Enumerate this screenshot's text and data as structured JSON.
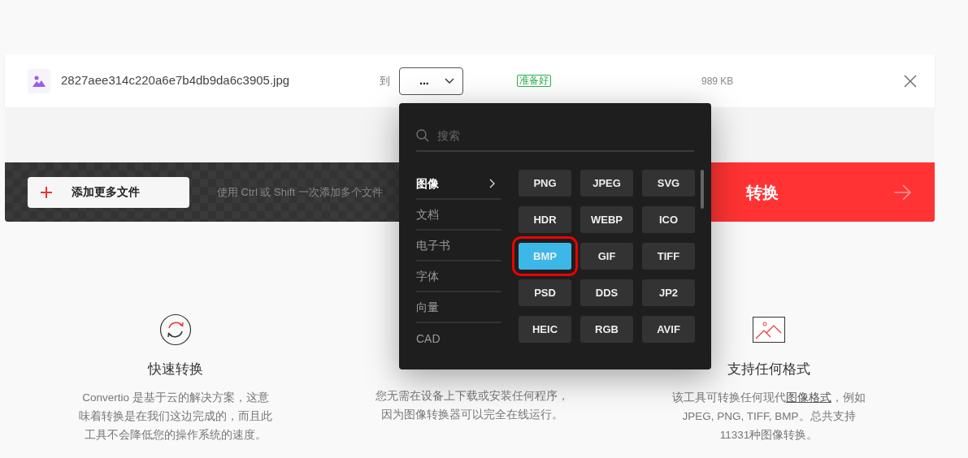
{
  "file": {
    "name": "2827aee314c220a6e7b4db9da6c3905.jpg",
    "to_label": "到",
    "format_select": {
      "value": "..."
    },
    "status": "准备好",
    "size": "989 KB"
  },
  "toolbar": {
    "add_button": "添加更多文件",
    "hint": "使用 Ctrl 或 Shift 一次添加多个文件",
    "convert_button": "转换"
  },
  "dropdown": {
    "search": {
      "placeholder": "搜索"
    },
    "categories": [
      {
        "label": "图像",
        "selected": true
      },
      {
        "label": "文档",
        "selected": false
      },
      {
        "label": "电子书",
        "selected": false
      },
      {
        "label": "字体",
        "selected": false
      },
      {
        "label": "向量",
        "selected": false
      },
      {
        "label": "CAD",
        "selected": false
      }
    ],
    "formats": [
      {
        "label": "PNG",
        "selected": false
      },
      {
        "label": "JPEG",
        "selected": false
      },
      {
        "label": "SVG",
        "selected": false
      },
      {
        "label": "HDR",
        "selected": false
      },
      {
        "label": "WEBP",
        "selected": false
      },
      {
        "label": "ICO",
        "selected": false
      },
      {
        "label": "BMP",
        "selected": true
      },
      {
        "label": "GIF",
        "selected": false
      },
      {
        "label": "TIFF",
        "selected": false
      },
      {
        "label": "PSD",
        "selected": false
      },
      {
        "label": "DDS",
        "selected": false
      },
      {
        "label": "JP2",
        "selected": false
      },
      {
        "label": "HEIC",
        "selected": false
      },
      {
        "label": "RGB",
        "selected": false
      },
      {
        "label": "AVIF",
        "selected": false
      }
    ]
  },
  "features": [
    {
      "title": "快速转换",
      "description": [
        {
          "kind": "text",
          "text": "Convertio 是基于云的解决方案，这意"
        },
        {
          "kind": "break"
        },
        {
          "kind": "text",
          "text": "味着转换是在我们这边完成的，而且此"
        },
        {
          "kind": "break"
        },
        {
          "kind": "text",
          "text": "工具不会降低您的操作系统的速度。"
        }
      ]
    },
    {
      "description": [
        {
          "kind": "text",
          "text": "您无需在设备上下载或安装任何程序，"
        },
        {
          "kind": "break"
        },
        {
          "kind": "text",
          "text": "因为图像转换器可以完全在线运行。"
        }
      ]
    },
    {
      "title": "支持任何格式",
      "description": [
        {
          "kind": "text",
          "text": "该工具可转换任何现代"
        },
        {
          "kind": "link",
          "text": "图像格式"
        },
        {
          "kind": "text",
          "text": "，例如"
        },
        {
          "kind": "break"
        },
        {
          "kind": "text",
          "text": "JPEG, PNG, TIFF, BMP。总共支持"
        },
        {
          "kind": "break"
        },
        {
          "kind": "text",
          "text": "11331种图像转换。"
        }
      ]
    }
  ]
}
